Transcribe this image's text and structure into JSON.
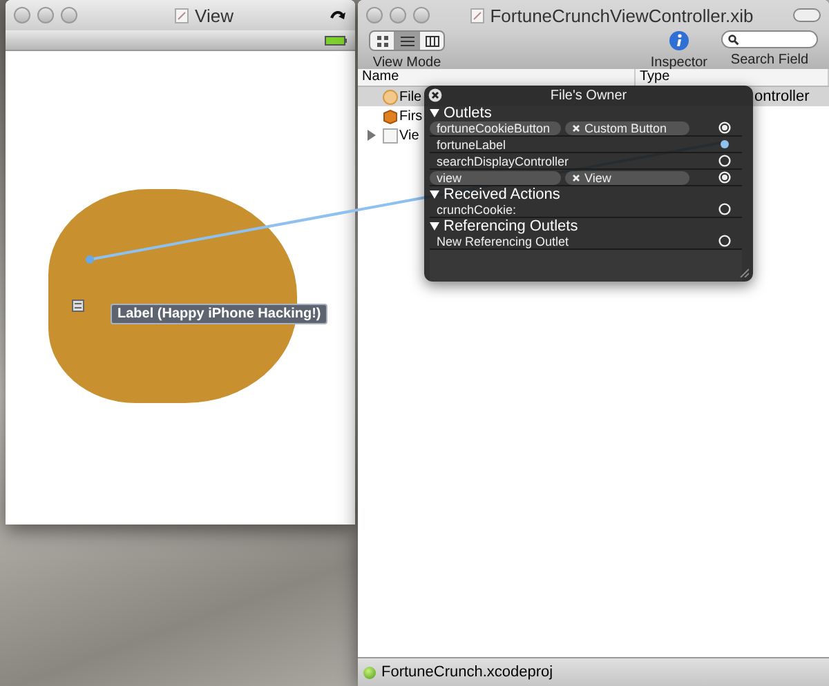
{
  "left_window": {
    "title": "View",
    "label": "Label (Happy iPhone Hacking!)"
  },
  "right_window": {
    "title": "FortuneCrunchViewController.xib",
    "view_mode": {
      "label": "View Mode",
      "segments": [
        {
          "selected": false
        },
        {
          "selected": true
        },
        {
          "selected": false
        }
      ]
    },
    "inspector": {
      "label": "Inspector"
    },
    "search": {
      "label": "Search Field"
    },
    "table": {
      "columns": [
        "Name",
        "Type"
      ],
      "rows": [
        {
          "kind": "owner",
          "name": "File",
          "type": "ontroller",
          "selected": true
        },
        {
          "kind": "responder",
          "name": "Firs",
          "selected": false
        },
        {
          "kind": "view",
          "name": "Vie",
          "selected": false,
          "expanded": false
        }
      ]
    },
    "status_bar": "FortuneCrunch.xcodeproj"
  },
  "hud": {
    "title": "File's Owner",
    "sections": [
      {
        "title": "Outlets",
        "rows": [
          {
            "name": "fortuneCookieButton",
            "target": "Custom Button",
            "connected": true
          },
          {
            "name": "fortuneLabel",
            "connected": true
          },
          {
            "name": "searchDisplayController",
            "connected": false
          },
          {
            "name": "view",
            "target": "View",
            "connected": true
          }
        ]
      },
      {
        "title": "Received Actions",
        "rows": [
          {
            "name": "crunchCookie:",
            "connected": false
          }
        ]
      },
      {
        "title": "Referencing Outlets",
        "rows": [
          {
            "name": "New Referencing Outlet",
            "connected": false
          }
        ]
      }
    ]
  }
}
